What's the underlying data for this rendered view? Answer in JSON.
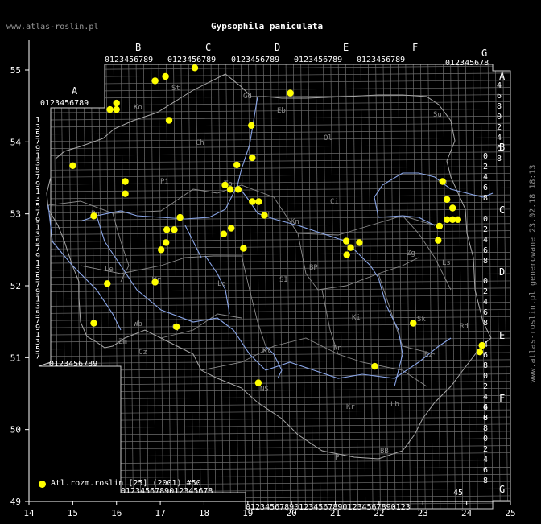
{
  "site_label": "www.atlas-roslin.pl",
  "title": "Gypsophila paniculata",
  "generated": "www.atlas-roslin.pl generowane 23.02.18 18:13",
  "legend": {
    "label": "Atl.rozm.roslin [25] (2001) #50",
    "color": "#ffff00"
  },
  "axes": {
    "x_ticks": [
      "14",
      "15",
      "16",
      "17",
      "18",
      "19",
      "20",
      "21",
      "22",
      "23",
      "24",
      "25"
    ],
    "y_ticks": [
      "55",
      "54",
      "53",
      "52",
      "51",
      "50",
      "49"
    ]
  },
  "grid_columns": [
    {
      "letter": "A",
      "digits": "0123456789"
    },
    {
      "letter": "B",
      "digits": "0123456789"
    },
    {
      "letter": "C",
      "digits": "0123456789"
    },
    {
      "letter": "D",
      "digits": "0123456789"
    },
    {
      "letter": "E",
      "digits": "0123456789"
    },
    {
      "letter": "F",
      "digits": "0123456789"
    },
    {
      "letter": "G",
      "digits": "012345678"
    }
  ],
  "bottom_row_a": "0123456789",
  "bottom_row_bb": "0123456789012345678",
  "bottom_row_c": "0123456789012345678901234567890123",
  "bottom_row_c_tail": "45",
  "left_digits": [
    "1",
    "3",
    "5",
    "7",
    "9",
    "1",
    "3",
    "5",
    "7",
    "9",
    "1",
    "3",
    "5",
    "7",
    "9",
    "1",
    "3",
    "5",
    "7",
    "9",
    "1",
    "3",
    "5",
    "7",
    "9",
    "1",
    "3",
    "5",
    "7",
    "9",
    "1",
    "3",
    "5",
    "7"
  ],
  "right_labels": {
    "groups": [
      {
        "letter": "A",
        "digits": [
          "4",
          "6",
          "8",
          "0",
          "2",
          "4",
          "6",
          "8"
        ]
      },
      {
        "letter": "B",
        "digits": [
          "0",
          "2",
          "4",
          "6",
          "8"
        ]
      },
      {
        "letter": "C",
        "digits": [
          "0",
          "2",
          "4",
          "6",
          "8"
        ]
      },
      {
        "letter": "D",
        "digits": [
          "0",
          "2",
          "4",
          "6",
          "8"
        ]
      },
      {
        "letter": "E",
        "digits": [
          "4",
          "6",
          "8",
          "0",
          "2",
          "4",
          "6",
          "8"
        ]
      },
      {
        "letter": "F",
        "digits": [
          "4",
          "6",
          "8",
          "0",
          "2",
          "4",
          "6",
          "8"
        ]
      },
      {
        "letter": "G",
        "digits": []
      }
    ]
  },
  "regions": [
    "St",
    "Gd",
    "Eb",
    "Ko",
    "Su",
    "Ch",
    "Ol",
    "Pi",
    "Bi",
    "Ci",
    "To",
    "Wl",
    "Po",
    "Kn",
    "Ld",
    "SI",
    "BP",
    "Zg",
    "Ls",
    "Le",
    "Wr",
    "Wb",
    "Op",
    "Cz",
    "Ki",
    "Rd",
    "Zm",
    "Kt",
    "Tr",
    "Rz",
    "NS",
    "Kr",
    "Lb",
    "Pr",
    "BB",
    "Sk"
  ],
  "chart_data": {
    "type": "scatter",
    "xlim": [
      14,
      25
    ],
    "ylim": [
      49,
      55.5
    ],
    "series": [
      {
        "name": "Atl.rozm.roslin [25] (2001) #50",
        "points": [
          [
            15.0,
            53.67
          ],
          [
            15.48,
            52.97
          ],
          [
            15.48,
            51.48
          ],
          [
            15.79,
            52.03
          ],
          [
            15.85,
            54.45
          ],
          [
            16.0,
            54.45
          ],
          [
            16.0,
            54.54
          ],
          [
            16.2,
            53.45
          ],
          [
            16.2,
            53.28
          ],
          [
            16.88,
            54.85
          ],
          [
            16.88,
            52.05
          ],
          [
            17.12,
            54.91
          ],
          [
            17.2,
            54.3
          ],
          [
            17.02,
            52.5
          ],
          [
            17.13,
            52.6
          ],
          [
            17.15,
            52.78
          ],
          [
            17.32,
            52.78
          ],
          [
            17.37,
            51.43
          ],
          [
            17.45,
            52.95
          ],
          [
            17.79,
            55.03
          ],
          [
            18.45,
            52.72
          ],
          [
            18.48,
            53.4
          ],
          [
            18.6,
            53.34
          ],
          [
            18.62,
            52.8
          ],
          [
            18.75,
            53.68
          ],
          [
            18.78,
            53.34
          ],
          [
            18.9,
            52.52
          ],
          [
            19.08,
            54.23
          ],
          [
            19.1,
            53.78
          ],
          [
            19.1,
            53.17
          ],
          [
            19.25,
            53.17
          ],
          [
            19.38,
            52.98
          ],
          [
            19.24,
            50.65
          ],
          [
            19.97,
            54.68
          ],
          [
            21.25,
            52.62
          ],
          [
            21.26,
            52.43
          ],
          [
            21.35,
            52.53
          ],
          [
            21.55,
            52.6
          ],
          [
            21.9,
            50.88
          ],
          [
            22.78,
            51.48
          ],
          [
            23.35,
            52.63
          ],
          [
            23.38,
            52.83
          ],
          [
            23.45,
            53.45
          ],
          [
            23.55,
            53.2
          ],
          [
            23.55,
            52.92
          ],
          [
            23.68,
            52.92
          ],
          [
            23.68,
            53.08
          ],
          [
            23.8,
            52.92
          ],
          [
            24.3,
            51.08
          ],
          [
            24.35,
            51.17
          ]
        ]
      }
    ]
  }
}
